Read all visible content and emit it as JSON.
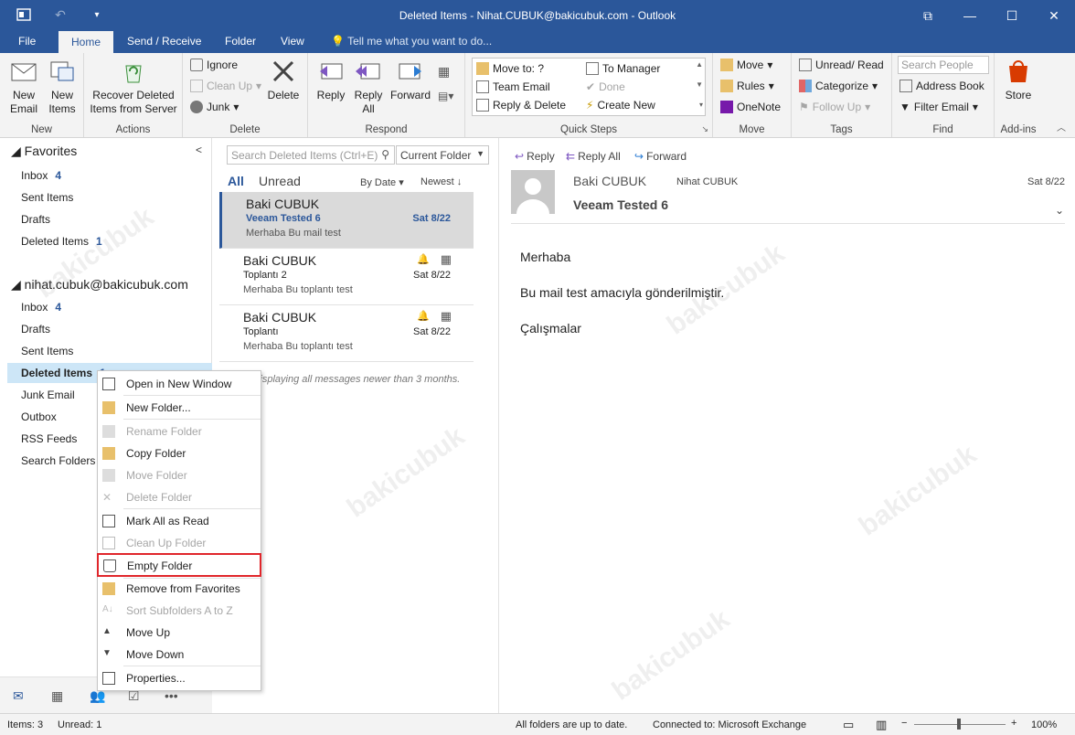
{
  "window": {
    "title": "Deleted Items - Nihat.CUBUK@bakicubuk.com - Outlook",
    "controls": [
      "restore-icon",
      "minimize-icon",
      "maximize-icon",
      "close-icon"
    ]
  },
  "tabs": [
    "File",
    "Home",
    "Send / Receive",
    "Folder",
    "View"
  ],
  "active_tab": "Home",
  "tell_me": "Tell me what you want to do...",
  "ribbon": {
    "new": {
      "new_email": "New Email",
      "new_items": "New Items",
      "label": "New"
    },
    "actions": {
      "recover": "Recover Deleted Items from Server",
      "label": "Actions"
    },
    "delete": {
      "ignore": "Ignore",
      "cleanup": "Clean Up",
      "junk": "Junk",
      "delete": "Delete",
      "label": "Delete"
    },
    "respond": {
      "reply": "Reply",
      "reply_all": "Reply All",
      "forward": "Forward",
      "label": "Respond"
    },
    "quick_steps": {
      "move_to": "Move to: ?",
      "team_email": "Team Email",
      "reply_delete": "Reply & Delete",
      "to_manager": "To Manager",
      "done": "Done",
      "create_new": "Create New",
      "label": "Quick Steps"
    },
    "move": {
      "move": "Move",
      "rules": "Rules",
      "onenote": "OneNote",
      "label": "Move"
    },
    "tags": {
      "unread_read": "Unread/ Read",
      "categorize": "Categorize",
      "follow_up": "Follow Up",
      "label": "Tags"
    },
    "find": {
      "search_people": "Search People",
      "address_book": "Address Book",
      "filter_email": "Filter Email",
      "label": "Find"
    },
    "addins": {
      "store": "Store",
      "label": "Add-ins"
    }
  },
  "folders": {
    "favorites_header": "Favorites",
    "favorites": [
      {
        "name": "Inbox",
        "count": "4"
      },
      {
        "name": "Sent Items",
        "count": ""
      },
      {
        "name": "Drafts",
        "count": ""
      },
      {
        "name": "Deleted Items",
        "count": "1"
      }
    ],
    "account": "nihat.cubuk@bakicubuk.com",
    "account_folders": [
      {
        "name": "Inbox",
        "count": "4"
      },
      {
        "name": "Drafts",
        "count": ""
      },
      {
        "name": "Sent Items",
        "count": ""
      },
      {
        "name": "Deleted Items",
        "count": "1"
      },
      {
        "name": "Junk Email",
        "count": ""
      },
      {
        "name": "Outbox",
        "count": ""
      },
      {
        "name": "RSS Feeds",
        "count": ""
      },
      {
        "name": "Search Folders",
        "count": ""
      }
    ]
  },
  "message_list": {
    "search_placeholder": "Search Deleted Items (Ctrl+E)",
    "scope": "Current Folder",
    "filter_all": "All",
    "filter_unread": "Unread",
    "sort_by": "By Date",
    "sort_order": "Newest",
    "messages": [
      {
        "sender": "Baki CUBUK",
        "subject": "Veeam Tested 6",
        "date": "Sat 8/22",
        "preview": "Merhaba  Bu mail test"
      },
      {
        "sender": "Baki CUBUK",
        "subject": "Toplantı 2",
        "date": "Sat 8/22",
        "preview": "Merhaba  Bu toplantı test"
      },
      {
        "sender": "Baki CUBUK",
        "subject": "Toplantı",
        "date": "Sat 8/22",
        "preview": "Merhaba  Bu toplantı test"
      }
    ],
    "footer_note": "...nly displaying all messages newer than 3 months."
  },
  "reading_pane": {
    "actions": [
      "Reply",
      "Reply All",
      "Forward"
    ],
    "from": "Baki CUBUK",
    "to": "Nihat CUBUK",
    "date": "Sat 8/22",
    "subject": "Veeam Tested 6",
    "body": [
      "Merhaba",
      "Bu mail test amacıyla gönderilmiştir.",
      "Çalışmalar"
    ]
  },
  "context_menu": {
    "items": [
      {
        "label": "Open in New Window",
        "disabled": false
      },
      {
        "label": "New Folder...",
        "disabled": false
      },
      {
        "label": "Rename Folder",
        "disabled": true
      },
      {
        "label": "Copy Folder",
        "disabled": false
      },
      {
        "label": "Move Folder",
        "disabled": true
      },
      {
        "label": "Delete Folder",
        "disabled": true
      },
      {
        "label": "Mark All as Read",
        "disabled": false
      },
      {
        "label": "Clean Up Folder",
        "disabled": true
      },
      {
        "label": "Empty Folder",
        "disabled": false
      },
      {
        "label": "Remove from Favorites",
        "disabled": false
      },
      {
        "label": "Sort Subfolders A to Z",
        "disabled": true
      },
      {
        "label": "Move Up",
        "disabled": false
      },
      {
        "label": "Move Down",
        "disabled": false
      },
      {
        "label": "Properties...",
        "disabled": false
      }
    ],
    "highlighted": "Empty Folder"
  },
  "status": {
    "items": "Items: 3",
    "unread": "Unread: 1",
    "sync": "All folders are up to date.",
    "connection": "Connected to: Microsoft Exchange",
    "zoom": "100%"
  },
  "colors": {
    "accent": "#2b579a",
    "highlight_border": "#e0262b",
    "selection": "#cde6f7"
  },
  "watermark": "bakicubuk"
}
